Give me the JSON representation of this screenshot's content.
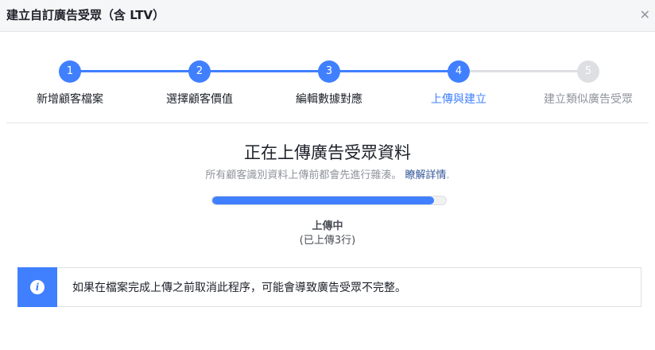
{
  "dialog": {
    "title": "建立自訂廣告受眾（含 LTV）",
    "close_icon": "close-icon"
  },
  "stepper": {
    "steps": [
      {
        "number": "1",
        "label": "新增顧客檔案",
        "state": "complete"
      },
      {
        "number": "2",
        "label": "選擇顧客價值",
        "state": "complete"
      },
      {
        "number": "3",
        "label": "編輯數據對應",
        "state": "complete"
      },
      {
        "number": "4",
        "label": "上傳與建立",
        "state": "active"
      },
      {
        "number": "5",
        "label": "建立類似廣告受眾",
        "state": "pending"
      }
    ],
    "colors": {
      "active": "#4080ff",
      "pending": "#dddfe2",
      "active_label": "#4080ff",
      "label": "#1d2129",
      "pending_label": "#90949c"
    }
  },
  "upload": {
    "title": "正在上傳廣告受眾資料",
    "subtitle": "所有顧客識別資料上傳前都會先進行雜湊。",
    "learn_more": "瞭解詳情",
    "period": ".",
    "progress_fraction": 0.95,
    "status": "上傳中",
    "detail": "(已上傳3行)"
  },
  "notice": {
    "icon": "info-icon",
    "text": "如果在檔案完成上傳之前取消此程序，可能會導致廣告受眾不完整。"
  }
}
